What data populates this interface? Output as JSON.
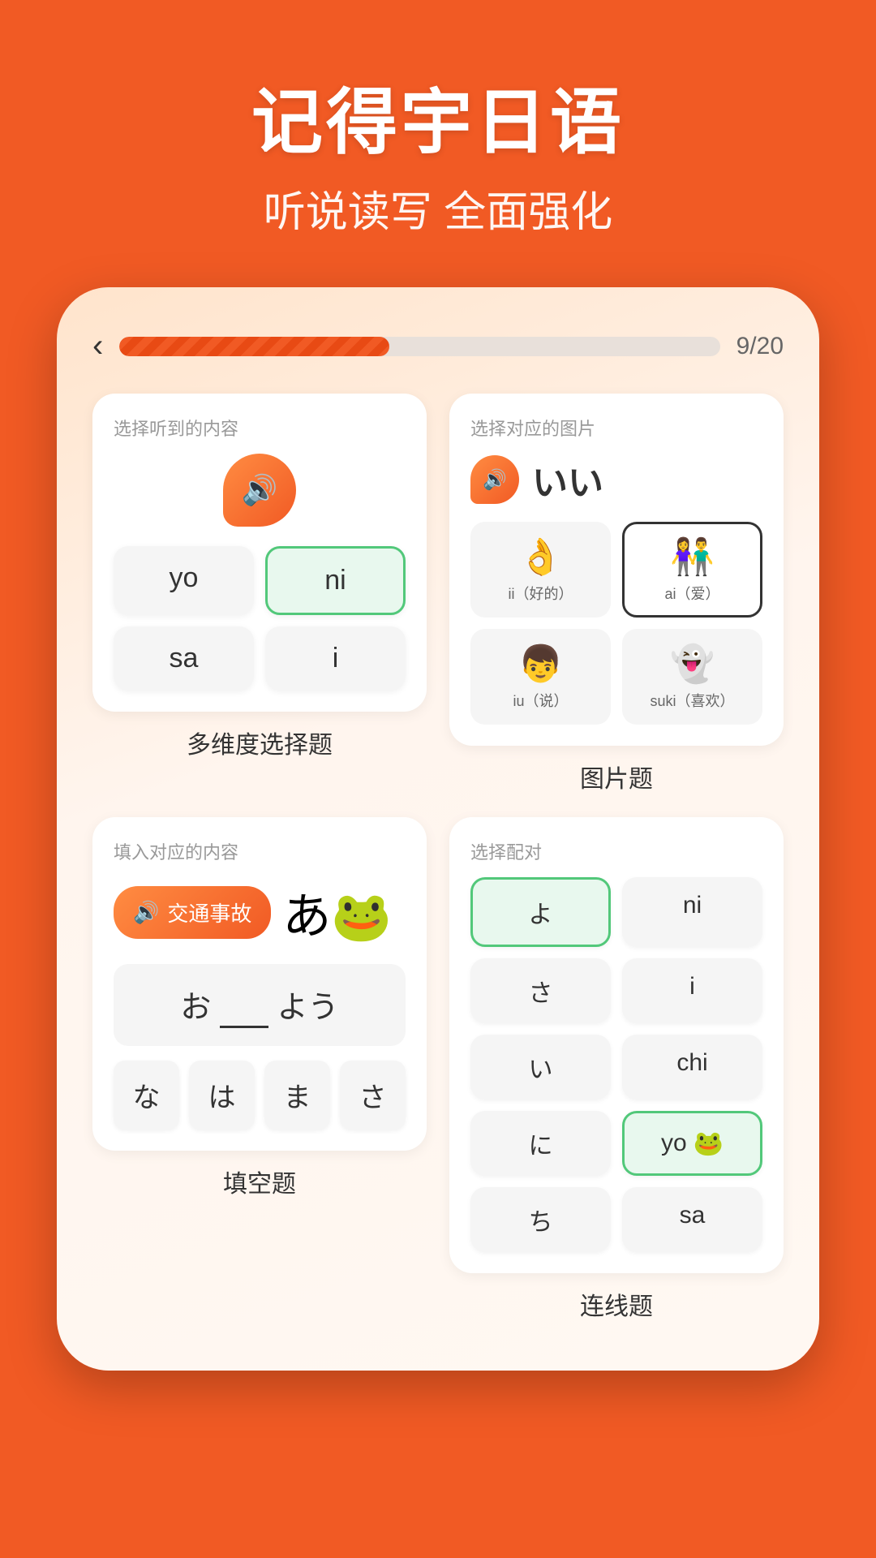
{
  "header": {
    "title": "记得宇日语",
    "subtitle": "听说读写 全面强化"
  },
  "progress": {
    "back_label": "‹",
    "current": 9,
    "total": 20,
    "display": "9/20",
    "percent": 45
  },
  "card1": {
    "label": "选择听到的内容",
    "choices": [
      "yo",
      "ni",
      "sa",
      "i"
    ],
    "selected_index": 1,
    "bottom_label": "多维度选择题"
  },
  "card2": {
    "label": "选择对应的图片",
    "hiragana": "いい",
    "options": [
      {
        "label": "ii（好的）",
        "emoji": "👌"
      },
      {
        "label": "ai（爱）",
        "emoji": "👫"
      },
      {
        "label": "iu（说）",
        "emoji": "👦"
      },
      {
        "label": "suki（喜欢）",
        "emoji": "👻"
      }
    ],
    "selected_index": 1,
    "bottom_label": "图片题"
  },
  "card3": {
    "label": "填入对应的内容",
    "audio_text": "交通事故",
    "sentence_before": "お",
    "sentence_after": "よう",
    "mascot": "🐸",
    "char_options": [
      "な",
      "は",
      "ま",
      "さ"
    ],
    "bottom_label": "填空题"
  },
  "card4": {
    "label": "选择配对",
    "left_options": [
      "よ",
      "さ",
      "い",
      "に",
      "ち"
    ],
    "right_options": [
      "ni",
      "i",
      "chi",
      "yo",
      "sa"
    ],
    "selected_left": 0,
    "selected_right": 3,
    "bottom_label": "连线题"
  }
}
